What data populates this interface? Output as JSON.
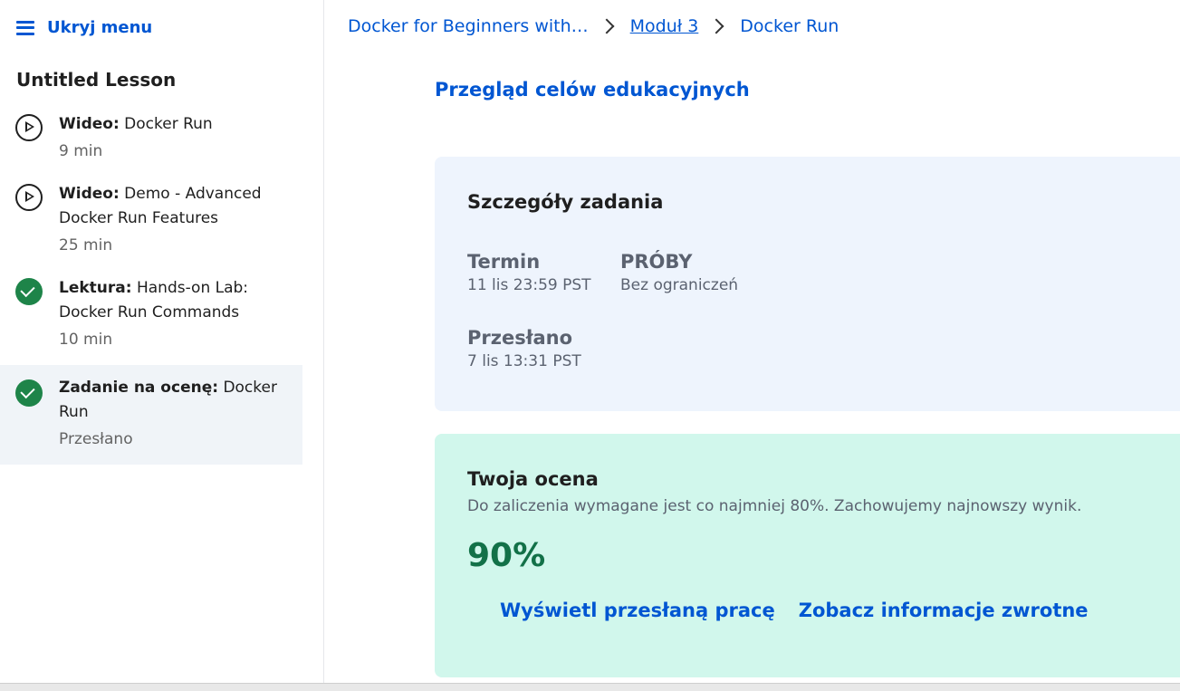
{
  "sidebar": {
    "toggle_label": "Ukryj menu",
    "lesson_title": "Untitled Lesson",
    "items": [
      {
        "type": "Wideo:",
        "title": "Docker Run",
        "meta": "9 min",
        "icon": "play-circle-icon"
      },
      {
        "type": "Wideo:",
        "title": "Demo - Advanced Docker Run Features",
        "meta": "25 min",
        "icon": "play-circle-icon"
      },
      {
        "type": "Lektura:",
        "title": "Hands-on Lab: Docker Run Commands",
        "meta": "10 min",
        "icon": "check-circle-icon"
      },
      {
        "type": "Zadanie na ocenę:",
        "title": "Docker Run",
        "meta": "Przesłano",
        "icon": "check-circle-icon"
      }
    ]
  },
  "breadcrumb": {
    "course": "Docker for Beginners with…",
    "module": "Moduł 3",
    "current": "Docker Run"
  },
  "review_link": "Przegląd celów edukacyjnych",
  "details": {
    "title": "Szczegóły zadania",
    "deadline_label": "Termin",
    "deadline_value": "11 lis 23:59 PST",
    "attempts_label": "PRÓBY",
    "attempts_value": "Bez ograniczeń",
    "submitted_label": "Przesłano",
    "submitted_value": "7 lis 13:31 PST"
  },
  "grade": {
    "title": "Twoja ocena",
    "description": "Do zaliczenia wymagane jest co najmniej 80%. Zachowujemy najnowszy wynik.",
    "score": "90%",
    "view_submission": "Wyświetl przesłaną pracę",
    "view_feedback": "Zobacz informacje zwrotne"
  },
  "colors": {
    "link": "#0056d2",
    "details_bg": "#eef4fd",
    "grade_bg": "#d1f7ec",
    "score": "#127148",
    "check": "#1e8449"
  }
}
